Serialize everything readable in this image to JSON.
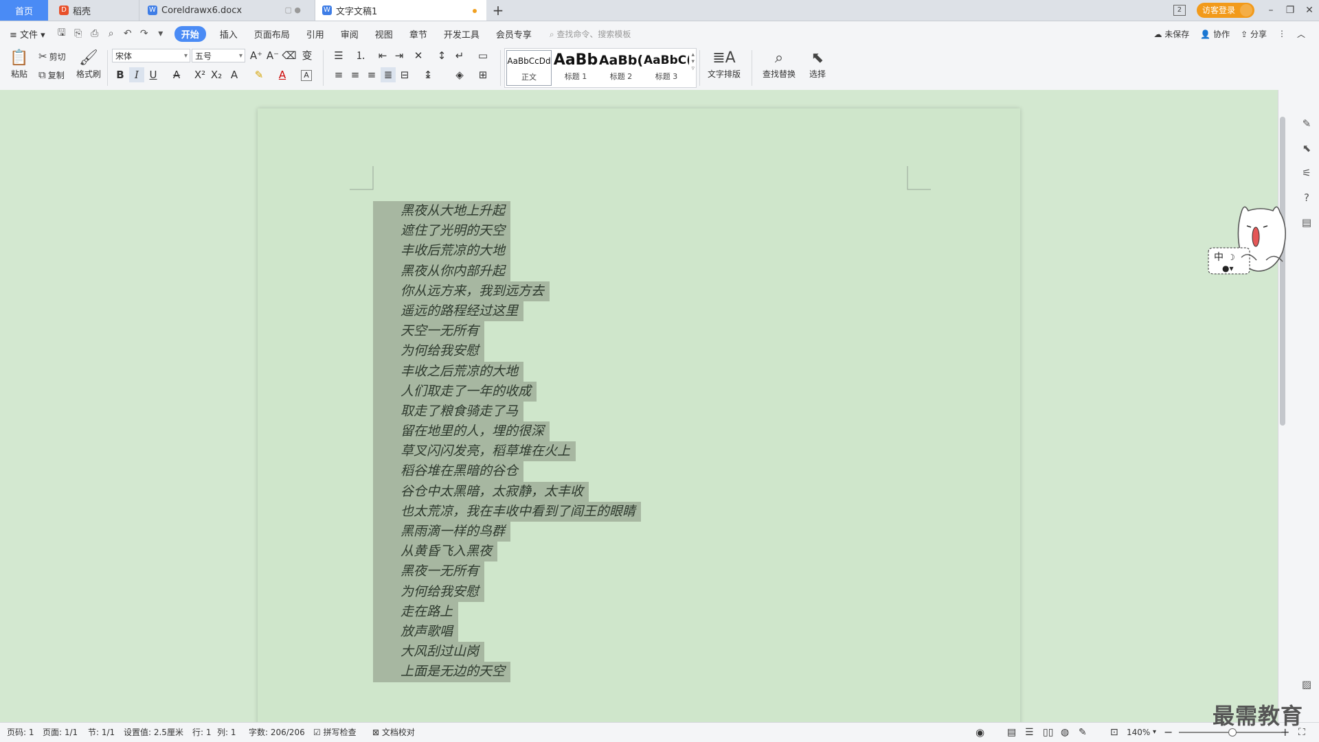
{
  "tabs": {
    "home": "首页",
    "daoke": "稻壳",
    "doc1": "Coreldrawx6.docx",
    "doc2": "文字文稿1",
    "add": "+"
  },
  "window": {
    "login": "访客登录",
    "badge": "2"
  },
  "menu": {
    "file": "文件",
    "items": [
      "开始",
      "插入",
      "页面布局",
      "引用",
      "审阅",
      "视图",
      "章节",
      "开发工具",
      "会员专享"
    ],
    "search_placeholder": "查找命令、搜索模板",
    "unsaved": "未保存",
    "collab": "协作",
    "share": "分享"
  },
  "ribbon": {
    "paste": "粘贴",
    "cut": "剪切",
    "copy": "复制",
    "format_painter": "格式刷",
    "font_name": "宋体",
    "font_size": "五号",
    "styles": [
      {
        "preview": "AaBbCcDd",
        "name": "正文"
      },
      {
        "preview": "AaBb",
        "name": "标题 1"
      },
      {
        "preview": "AaBb(",
        "name": "标题 2"
      },
      {
        "preview": "AaBbC(",
        "name": "标题 3"
      }
    ],
    "text_layout": "文字排版",
    "find_replace": "查找替换",
    "select": "选择"
  },
  "document": {
    "lines": [
      "黑夜从大地上升起",
      "遮住了光明的天空",
      "丰收后荒凉的大地",
      "黑夜从你内部升起",
      "你从远方来，我到远方去",
      "遥远的路程经过这里",
      "天空一无所有",
      "为何给我安慰",
      "丰收之后荒凉的大地",
      "人们取走了一年的收成",
      "取走了粮食骑走了马",
      "留在地里的人，埋的很深",
      "草叉闪闪发亮，稻草堆在火上",
      "稻谷堆在黑暗的谷仓",
      "谷仓中太黑暗，太寂静，太丰收",
      "也太荒凉，我在丰收中看到了阎王的眼睛",
      "黑雨滴一样的鸟群",
      "从黄昏飞入黑夜",
      "黑夜一无所有",
      "为何给我安慰",
      "走在路上",
      "放声歌唱",
      "大风刮过山岗",
      "上面是无边的天空"
    ]
  },
  "ime": {
    "label": "中"
  },
  "status": {
    "page_no": "页码: 1",
    "pages": "页面: 1/1",
    "section": "节: 1/1",
    "setting": "设置值: 2.5厘米",
    "row": "行: 1",
    "col": "列: 1",
    "words": "字数: 206/206",
    "spell": "拼写检查",
    "proof": "文档校对",
    "zoom": "140%"
  },
  "watermark": "最需教育",
  "colors": {
    "accent": "#4a8bf5",
    "login": "#f29a1a",
    "page_bg": "#cfe6cb",
    "selection": "#a7b7a1"
  }
}
